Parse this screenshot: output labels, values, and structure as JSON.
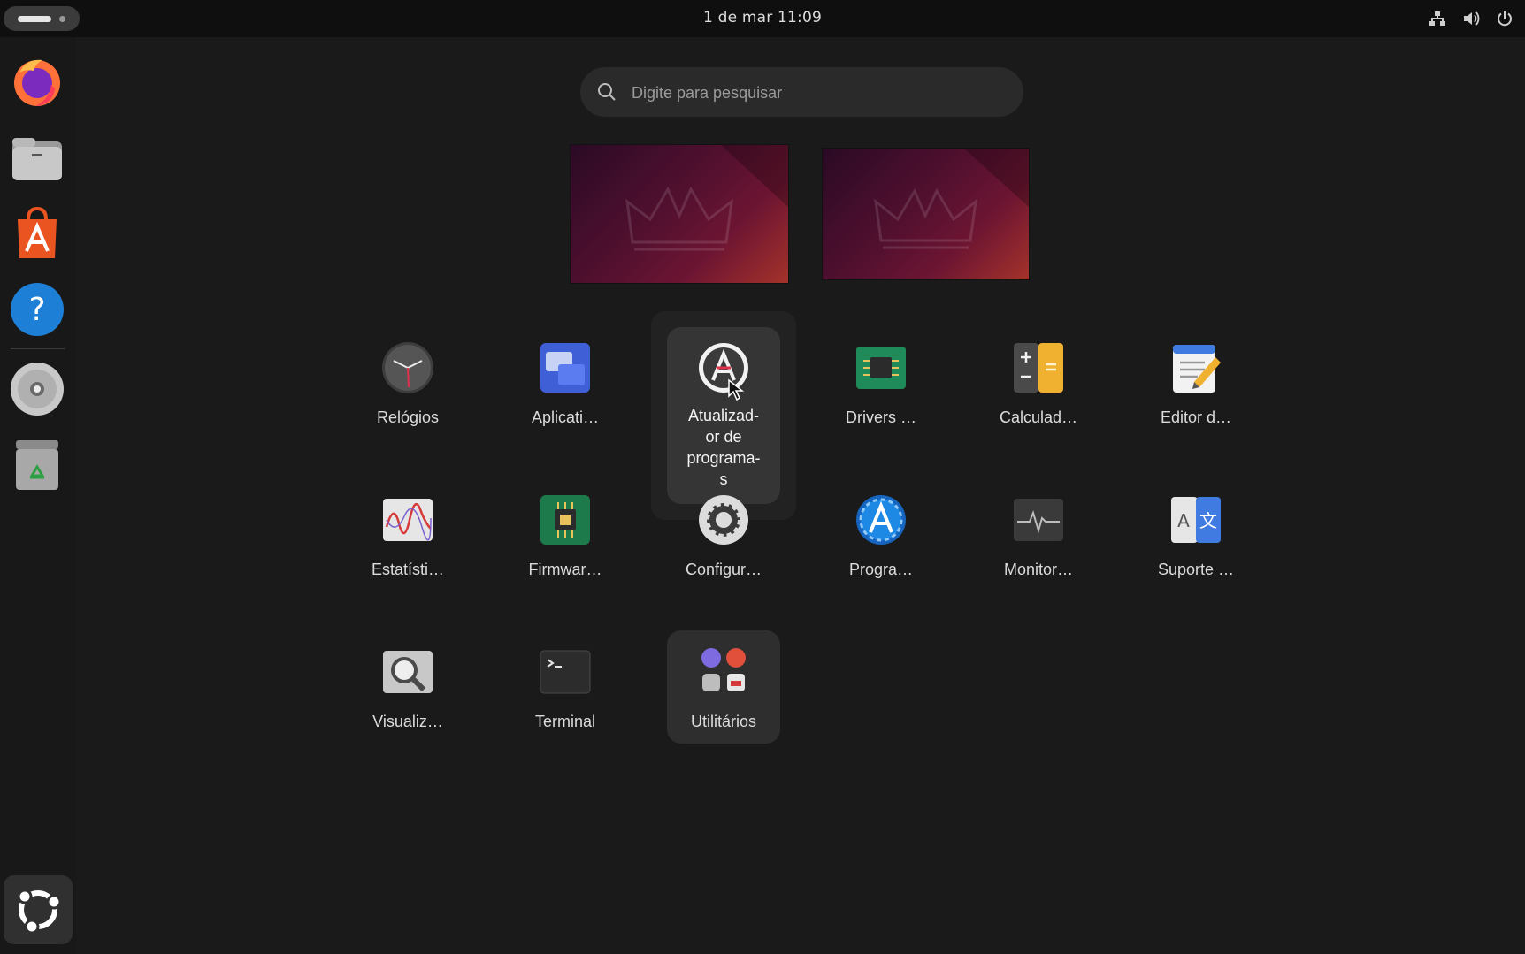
{
  "topbar": {
    "datetime": "1 de mar  11:09",
    "tray_icons": [
      "network-icon",
      "volume-icon",
      "power-icon"
    ]
  },
  "dock": {
    "items": [
      {
        "name": "firefox-icon"
      },
      {
        "name": "files-icon"
      },
      {
        "name": "app-center-icon"
      },
      {
        "name": "help-icon"
      },
      {
        "name": "disc-icon"
      },
      {
        "name": "trash-icon"
      }
    ],
    "show_apps": "ubuntu-logo-icon"
  },
  "search": {
    "placeholder": "Digite para pesquisar"
  },
  "apps": {
    "row1": [
      "Relógios",
      "Aplicati…",
      "Atualizad-\nor de\nprograma-\ns",
      "Drivers …",
      "Calculad…",
      "Editor d…"
    ],
    "row2": [
      "Estatísti…",
      "Firmwar…",
      "Configur…",
      "Progra…",
      "Monitor…",
      "Suporte …"
    ],
    "row3": [
      "Visualiz…",
      "Terminal",
      "Utilitários"
    ]
  },
  "colors": {
    "accent": "#e95420",
    "background": "#1a1a1a",
    "topbar": "#0f0f0f"
  }
}
